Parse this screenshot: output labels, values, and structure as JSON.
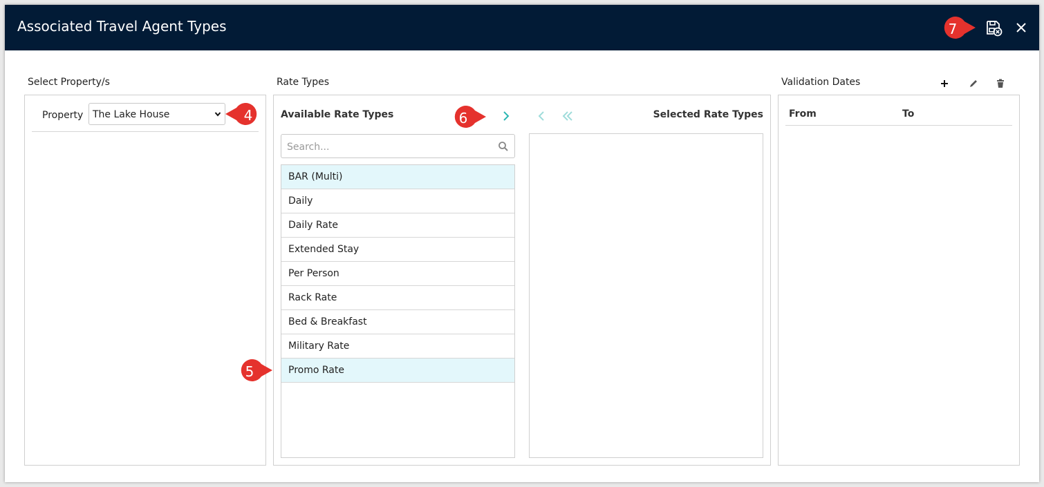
{
  "dialog": {
    "title": "Associated Travel Agent Types"
  },
  "sections": {
    "property": "Select Property/s",
    "rate_types": "Rate Types",
    "validation": "Validation Dates"
  },
  "property": {
    "label": "Property",
    "selected": "The Lake House"
  },
  "rate_types": {
    "available_title": "Available Rate Types",
    "selected_title": "Selected Rate Types",
    "search_placeholder": "Search...",
    "items": [
      {
        "label": "BAR (Multi)",
        "selected": true
      },
      {
        "label": "Daily",
        "selected": false
      },
      {
        "label": "Daily Rate",
        "selected": false
      },
      {
        "label": "Extended Stay",
        "selected": false
      },
      {
        "label": "Per Person",
        "selected": false
      },
      {
        "label": "Rack Rate",
        "selected": false
      },
      {
        "label": "Bed & Breakfast",
        "selected": false
      },
      {
        "label": "Military Rate",
        "selected": false
      },
      {
        "label": "Promo Rate",
        "selected": true
      }
    ]
  },
  "validation": {
    "col_from": "From",
    "col_to": "To"
  },
  "callouts": {
    "c4": "4",
    "c5": "5",
    "c6": "6",
    "c7": "7"
  },
  "colors": {
    "header": "#021b36",
    "callout": "#e5322d",
    "arrow": "#2bb7b3",
    "selected_row": "#e3f7fb"
  },
  "icons": {
    "save": "save-cancel-icon",
    "close": "close-icon",
    "add": "plus-icon",
    "edit": "pencil-icon",
    "delete": "trash-icon",
    "search": "search-icon",
    "move_right": "chevron-right-icon",
    "move_left": "chevron-left-icon",
    "move_all_left": "double-chevron-left-icon"
  }
}
